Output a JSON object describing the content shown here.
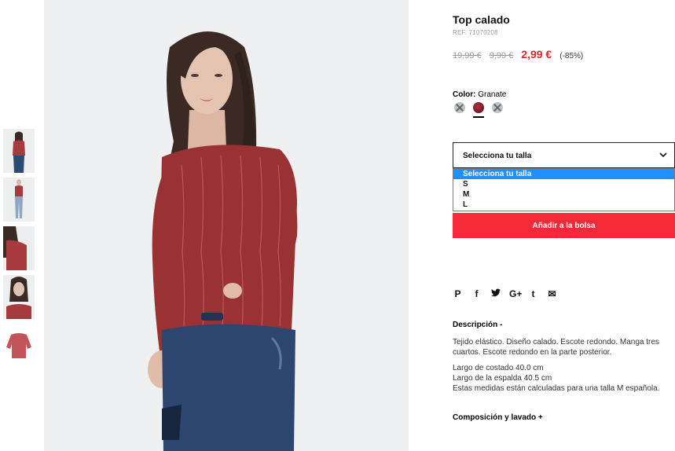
{
  "product": {
    "title": "Top calado",
    "ref": "REF. 71070208",
    "price_original": "19,99 €",
    "price_previous": "9,99 €",
    "price_current": "2,99 €",
    "discount": "(-85%)"
  },
  "color": {
    "label": "Color:",
    "value": "Granate",
    "swatches": [
      "grey-unavailable",
      "granate",
      "grey-unavailable"
    ]
  },
  "size": {
    "select_value": "Selecciona tu talla",
    "options": [
      "Selecciona tu talla",
      "S",
      "M",
      "L"
    ]
  },
  "add_button": "Añadir a la bolsa",
  "social": {
    "pinterest": "P",
    "facebook": "f",
    "twitter": "🐦",
    "googleplus": "G+",
    "tumblr": "t",
    "email": "✉"
  },
  "description": {
    "heading": "Descripción  -",
    "text": "Tejido elástico. Diseño calado. Escote redondo. Manga tres cuartos. Escote redondo en la parte posterior.",
    "line1": "Largo de costado 40.0 cm",
    "line2": "Largo de la espalda 40.5 cm",
    "line3": "Estas medidas están calculadas para una talla M española."
  },
  "composition_heading": "Composición y lavado  +",
  "colors": {
    "accent": "#f52a38",
    "price": "#e8212f",
    "selected_option": "#1e90ff"
  }
}
